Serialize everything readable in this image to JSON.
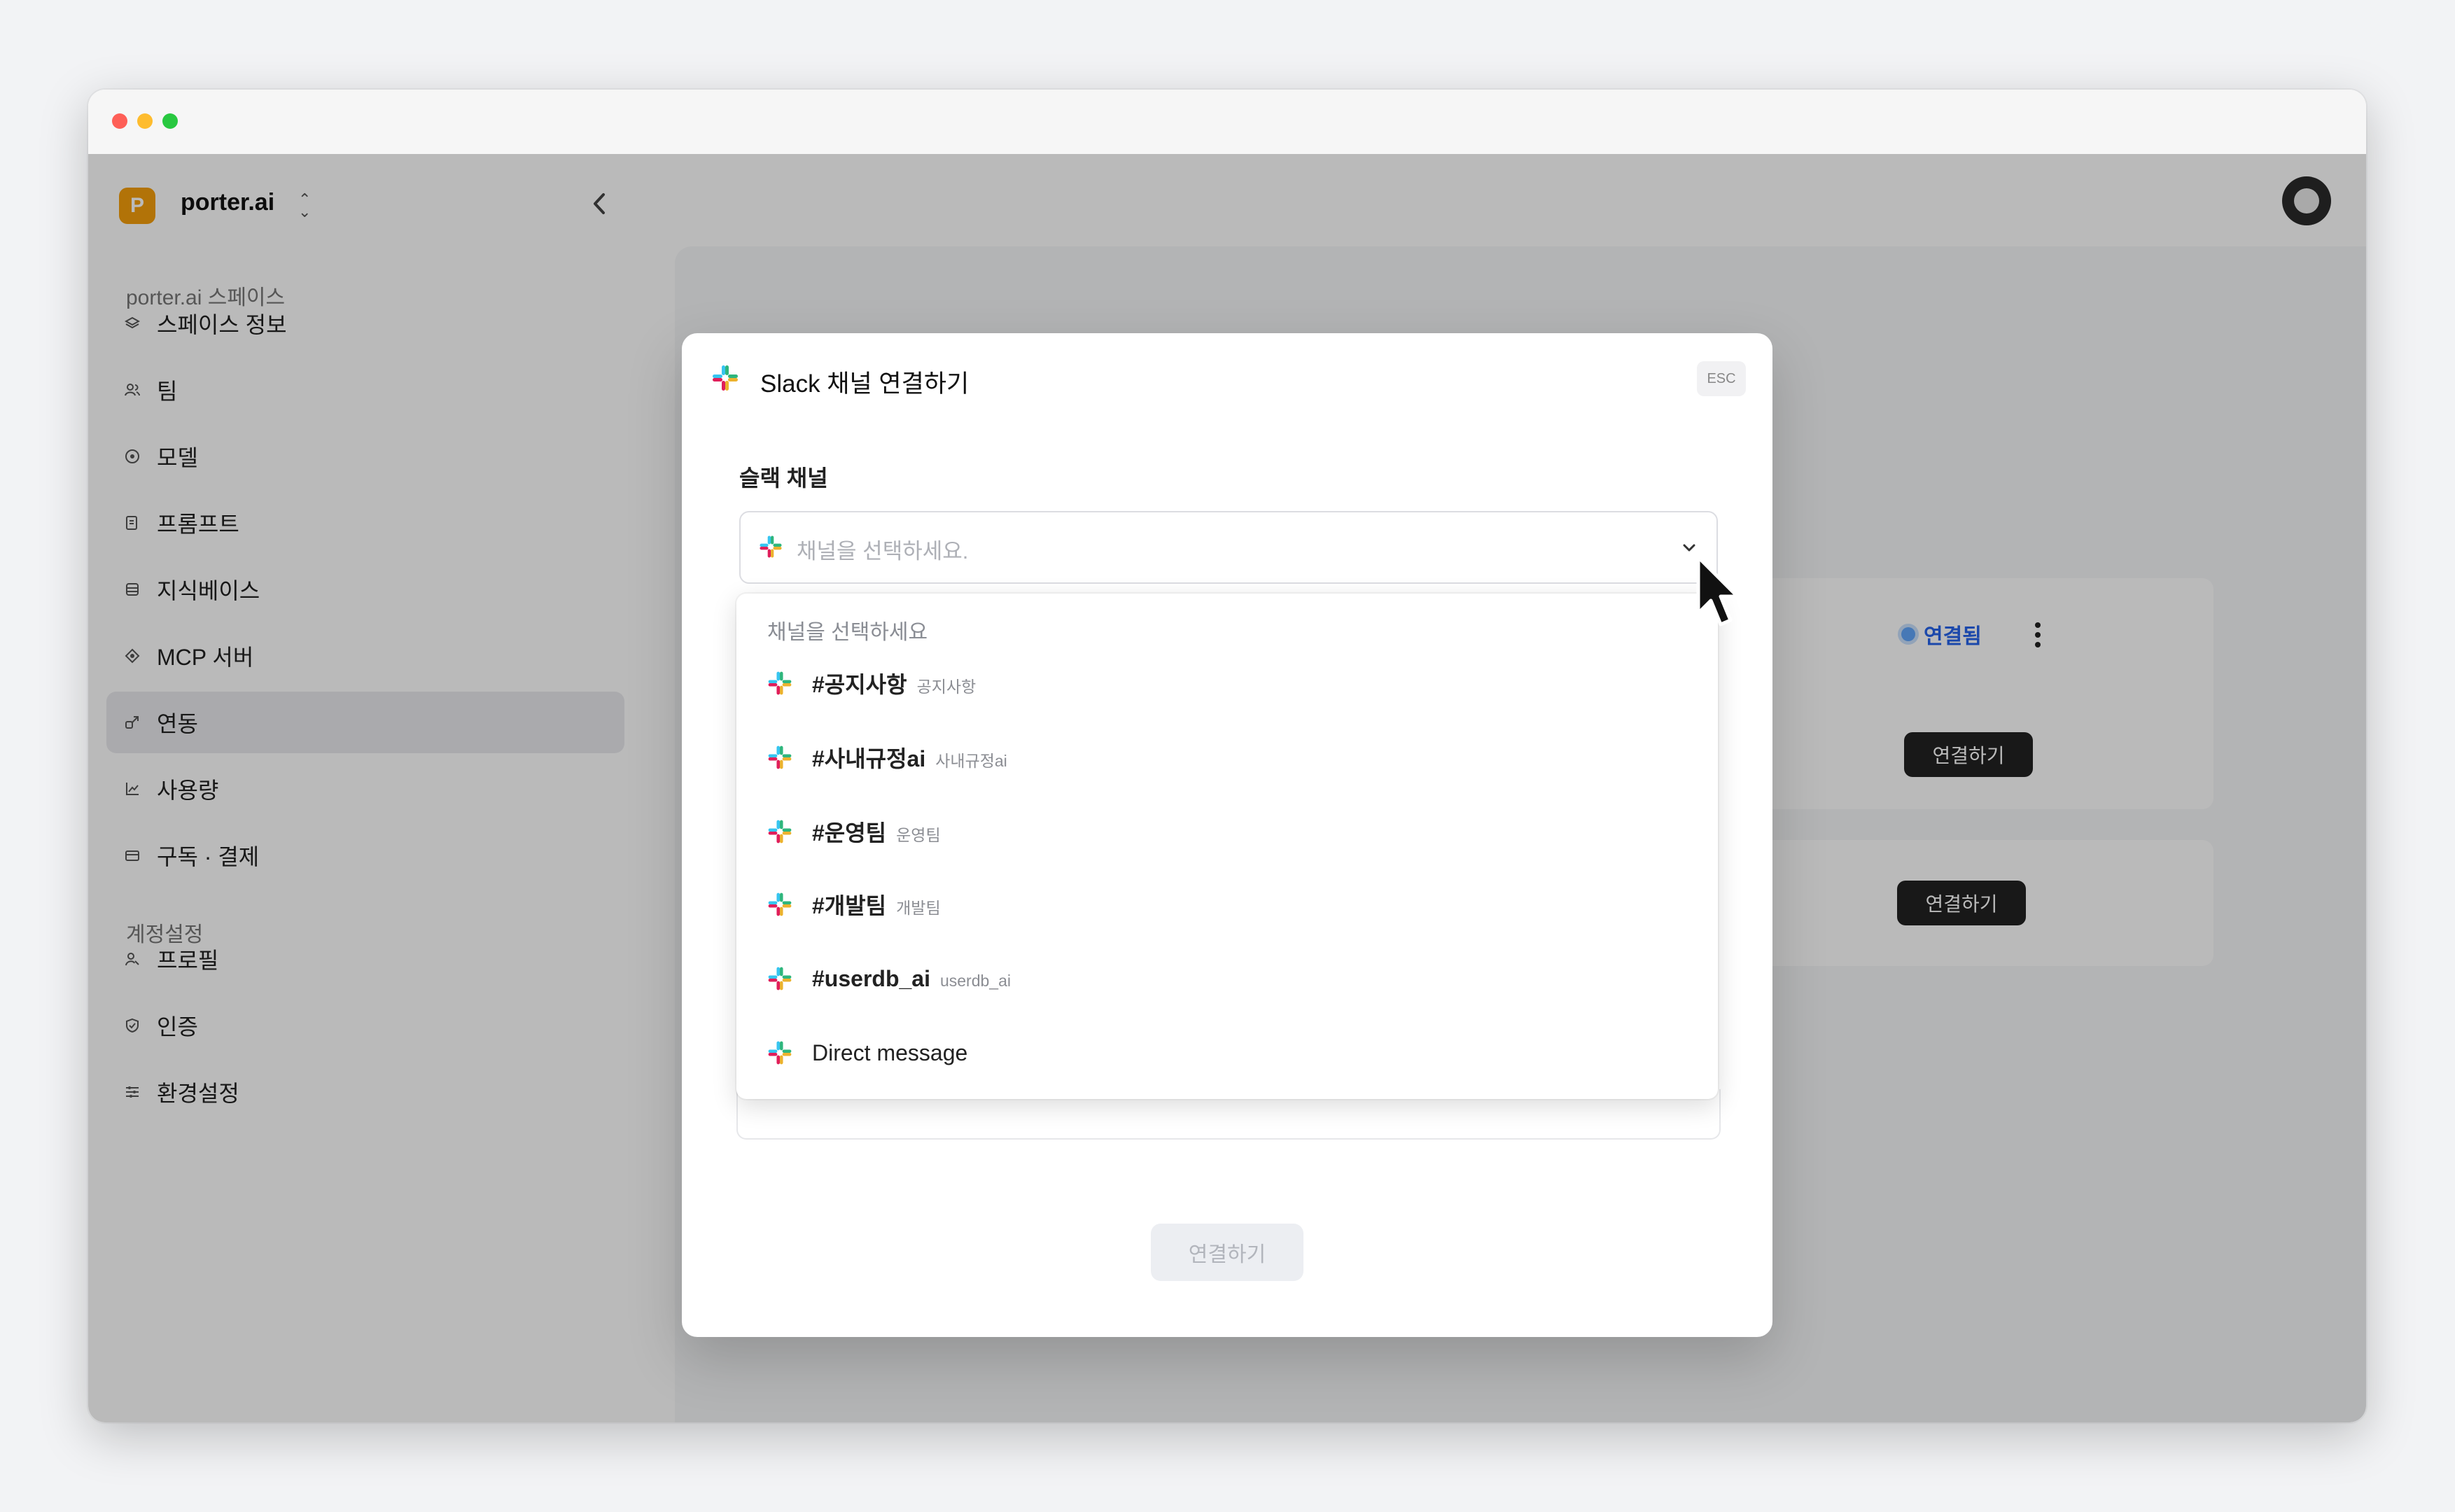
{
  "sidebar": {
    "workspace": {
      "logo_letter": "P",
      "name": "porter.ai"
    },
    "space_section_title": "porter.ai 스페이스",
    "items": [
      {
        "label": "스페이스 정보",
        "icon": "layers-icon"
      },
      {
        "label": "팀",
        "icon": "team-icon"
      },
      {
        "label": "모델",
        "icon": "model-icon"
      },
      {
        "label": "프롬프트",
        "icon": "prompt-icon"
      },
      {
        "label": "지식베이스",
        "icon": "database-icon"
      },
      {
        "label": "MCP 서버",
        "icon": "mcp-icon"
      },
      {
        "label": "연동",
        "icon": "integration-icon",
        "active": true
      },
      {
        "label": "사용량",
        "icon": "chart-icon"
      },
      {
        "label": "구독 · 결제",
        "icon": "card-icon"
      }
    ],
    "account_section_title": "계정설정",
    "account_items": [
      {
        "label": "프로필",
        "icon": "profile-icon"
      },
      {
        "label": "인증",
        "icon": "shield-icon"
      },
      {
        "label": "환경설정",
        "icon": "settings-icon"
      }
    ]
  },
  "background": {
    "status_connected": "연결됨",
    "connect_label_1": "연결하기",
    "connect_label_2": "연결하기"
  },
  "modal": {
    "title": "Slack 채널 연결하기",
    "esc_label": "ESC",
    "field_label": "슬랙 채널",
    "select_placeholder": "채널을 선택하세요.",
    "dropdown_header": "채널을 선택하세요",
    "options": [
      {
        "name": "#공지사항",
        "sub": "공지사항"
      },
      {
        "name": "#사내규정ai",
        "sub": "사내규정ai"
      },
      {
        "name": "#운영팀",
        "sub": "운영팀"
      },
      {
        "name": "#개발팀",
        "sub": "개발팀"
      },
      {
        "name": "#userdb_ai",
        "sub": "userdb_ai"
      },
      {
        "name": "Direct message",
        "sub": ""
      }
    ],
    "submit_label": "연결하기"
  },
  "colors": {
    "accent_blue": "#2563eb",
    "workspace_logo": "#f59e0b",
    "dark_button": "#222222"
  }
}
